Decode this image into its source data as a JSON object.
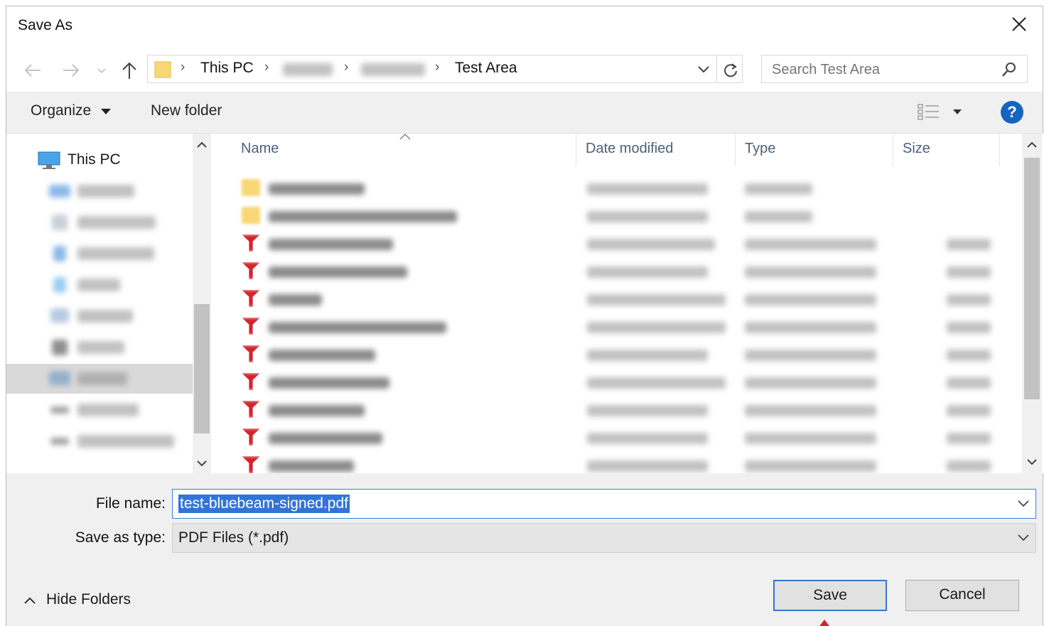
{
  "dialog": {
    "title": "Save As"
  },
  "nav": {
    "path": [
      "This PC",
      "Test Area"
    ],
    "search_placeholder": "Search Test Area"
  },
  "toolbar": {
    "organize_label": "Organize",
    "new_folder_label": "New folder"
  },
  "sidebar": {
    "items": [
      {
        "label": "This PC",
        "icon": "computer-icon"
      }
    ]
  },
  "columns": {
    "name": "Name",
    "date": "Date modified",
    "type": "Type",
    "size": "Size"
  },
  "files": {
    "kinds": [
      "folder",
      "folder",
      "pdf",
      "pdf",
      "pdf",
      "pdf",
      "pdf",
      "pdf",
      "pdf",
      "pdf",
      "pdf"
    ]
  },
  "form": {
    "file_name_label": "File name:",
    "file_name_value": "test-bluebeam-signed.pdf",
    "save_type_label": "Save as type:",
    "save_type_value": "PDF Files (*.pdf)"
  },
  "footer": {
    "hide_folders_label": "Hide Folders",
    "save_label": "Save",
    "cancel_label": "Cancel"
  },
  "colors": {
    "accent": "#3374d6",
    "help": "#1565c0",
    "pdf_red": "#d4242b",
    "folder": "#f8d775",
    "header_text": "#4c607a"
  }
}
